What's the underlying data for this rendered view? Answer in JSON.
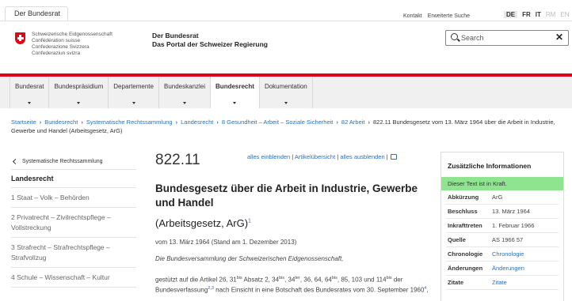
{
  "top": {
    "tab_label": "Der Bundesrat",
    "util_links": [
      "Kontakt",
      "Erweiterte Suche"
    ],
    "languages": [
      {
        "code": "DE",
        "state": "active"
      },
      {
        "code": "FR",
        "state": "normal"
      },
      {
        "code": "IT",
        "state": "normal"
      },
      {
        "code": "RM",
        "state": "disabled"
      },
      {
        "code": "EN",
        "state": "disabled"
      }
    ]
  },
  "header": {
    "logo_lines": [
      "Schweizerische Eidgenossenschaft",
      "Confédération suisse",
      "Confederazione Svizzera",
      "Confederaziun svizra"
    ],
    "portal_line1": "Der Bundesrat",
    "portal_line2": "Das Portal der Schweizer Regierung",
    "search_placeholder": "Search",
    "clear_glyph": "✕"
  },
  "nav": [
    {
      "label": "Bundesrat",
      "active": false
    },
    {
      "label": "Bundespräsidium",
      "active": false
    },
    {
      "label": "Departemente",
      "active": false
    },
    {
      "label": "Bundeskanzlei",
      "active": false
    },
    {
      "label": "Bundesrecht",
      "active": true
    },
    {
      "label": "Dokumentation",
      "active": false
    }
  ],
  "breadcrumb": {
    "links": [
      "Startseite",
      "Bundesrecht",
      "Systematische Rechtssammlung",
      "Landesrecht",
      "8 Gesundheit – Arbeit – Soziale Sicherheit",
      "82 Arbeit"
    ],
    "current": "822.11 Bundesgesetz vom 13. März 1964 über die Arbeit in Industrie, Gewerbe und Handel (Arbeitsgesetz, ArG)"
  },
  "sidebar": {
    "back_label": "Systematische Rechtssammlung",
    "heading": "Landesrecht",
    "items": [
      "1 Staat – Volk – Behörden",
      "2 Privatrecht – Zivilrechtspflege – Vollstreckung",
      "3 Strafrecht – Strafrechtspflege – Strafvollzug",
      "4 Schule – Wissenschaft – Kultur"
    ]
  },
  "main": {
    "sr_number": "822.11",
    "toolbar": {
      "show_all": "alles einblenden",
      "overview": "Artikelübersicht",
      "hide_all": "alles ausblenden",
      "separator": " | "
    },
    "title": "Bundesgesetz über die Arbeit in Industrie, Gewerbe und Handel",
    "short_title": "(Arbeitsgesetz, ArG)",
    "short_title_fn": "1",
    "date_line": "vom 13. März 1964 (Stand am 1. Dezember 2013)",
    "preamble": "Die Bundesversammlung der Schweizerischen Eidgenossenschaft,",
    "para": {
      "t1": "gestützt auf die Artikel 26, 31",
      "s1": "bis",
      "t2": " Absatz 2, 34",
      "s2": "bis",
      "t3": ", 34",
      "s3": "ter",
      "t4": ", 36, 64, 64",
      "s4": "bis",
      "t5": ", 85, 103 und 114",
      "s5": "bis",
      "t6": " der Bundesverfassung",
      "fn1": "2",
      "comma": ",",
      "fn2": "3",
      "t7": " nach Einsicht in eine Botschaft des Bundesrates vom 30. September 1960",
      "fn3": "4",
      "t8": ","
    }
  },
  "info": {
    "title": "Zusätzliche Informationen",
    "status": "Dieser Text ist in Kraft.",
    "rows": [
      {
        "key": "Abkürzung",
        "val": "ArG",
        "link": false
      },
      {
        "key": "Beschluss",
        "val": "13. März 1964",
        "link": false
      },
      {
        "key": "Inkrafttreten",
        "val": "1. Februar 1966",
        "link": false
      },
      {
        "key": "Quelle",
        "val": "AS 1966 57",
        "link": false
      },
      {
        "key": "Chronologie",
        "val": "Chronologie",
        "link": true
      },
      {
        "key": "Änderungen",
        "val": "Änderungen",
        "link": true
      },
      {
        "key": "Zitate",
        "val": "Zitate",
        "link": true
      }
    ]
  }
}
